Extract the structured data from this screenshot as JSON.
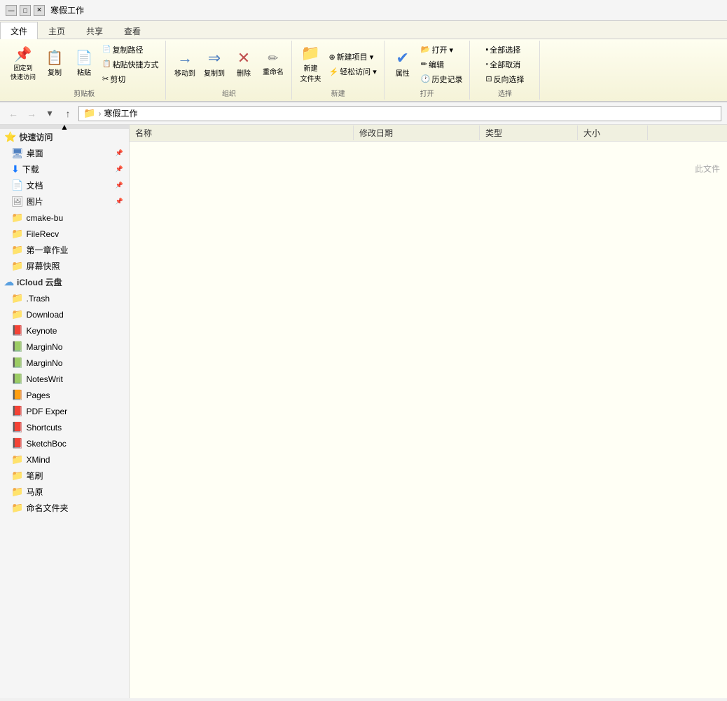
{
  "titleBar": {
    "icons": [
      "—",
      "□",
      "✕"
    ],
    "title": "寒假工作"
  },
  "ribbonTabs": [
    {
      "label": "文件",
      "active": true
    },
    {
      "label": "主页",
      "active": false
    },
    {
      "label": "共享",
      "active": false
    },
    {
      "label": "查看",
      "active": false
    }
  ],
  "ribbon": {
    "groups": [
      {
        "name": "clipboard",
        "label": "剪贴板",
        "buttons": [
          {
            "type": "large",
            "icon": "📌",
            "label": "固定到\n快速访问"
          },
          {
            "type": "large",
            "icon": "📋",
            "label": "复制"
          },
          {
            "type": "large",
            "icon": "📄",
            "label": "粘贴"
          },
          {
            "type": "small-col",
            "items": [
              {
                "label": "复制路径"
              },
              {
                "label": "粘贴快捷方式"
              },
              {
                "label": "✂ 剪切"
              }
            ]
          }
        ]
      },
      {
        "name": "organize",
        "label": "组织",
        "buttons": [
          {
            "type": "large-arrow",
            "label": "移动到"
          },
          {
            "type": "large-arrow",
            "label": "复制到"
          },
          {
            "type": "large-x",
            "label": "删除"
          },
          {
            "type": "large",
            "label": "重命名"
          }
        ]
      },
      {
        "name": "new",
        "label": "新建",
        "buttons": [
          {
            "type": "large-folder",
            "label": "新建\n文件夹"
          },
          {
            "type": "small-col",
            "items": [
              {
                "label": "⊕ 新建项目 ▾"
              },
              {
                "label": "⚡ 轻松访问 ▾"
              }
            ]
          }
        ]
      },
      {
        "name": "open",
        "label": "打开",
        "buttons": [
          {
            "type": "large-check",
            "label": "属性"
          },
          {
            "type": "small-col",
            "items": [
              {
                "label": "📂 打开 ▾"
              },
              {
                "label": "✏ 编辑"
              },
              {
                "label": "🕐 历史记录"
              }
            ]
          }
        ]
      },
      {
        "name": "select",
        "label": "选择",
        "buttons": [
          {
            "type": "small-col",
            "items": [
              {
                "label": "全部选择"
              },
              {
                "label": "全部取消"
              },
              {
                "label": "反向选择"
              }
            ]
          }
        ]
      }
    ]
  },
  "addressBar": {
    "backLabel": "←",
    "forwardLabel": "→",
    "dropLabel": "▾",
    "upLabel": "↑",
    "pathIcon": "📁",
    "pathSep": "›",
    "pathRoot": "寒假工作",
    "pathFull": "寒假工作"
  },
  "sidebar": {
    "scrollUp": "▲",
    "groups": [
      {
        "type": "header",
        "icon": "⭐",
        "label": "快速访问"
      },
      {
        "type": "pinned",
        "icon": "🖥",
        "label": "桌面",
        "pin": true
      },
      {
        "type": "pinned",
        "icon": "⬇",
        "label": "下载",
        "iconClass": "dl-icon",
        "pin": true
      },
      {
        "type": "pinned",
        "icon": "📄",
        "label": "文档",
        "iconClass": "doc-icon",
        "pin": true
      },
      {
        "type": "pinned",
        "icon": "🖼",
        "label": "图片",
        "iconClass": "img-icon",
        "pin": true
      },
      {
        "type": "folder",
        "icon": "📁",
        "label": "cmake-bu",
        "iconClass": "folder-yellow"
      },
      {
        "type": "folder",
        "icon": "📁",
        "label": "FileRecv",
        "iconClass": "folder-yellow"
      },
      {
        "type": "folder",
        "icon": "📁",
        "label": "第一章作业",
        "iconClass": "folder-yellow"
      },
      {
        "type": "folder",
        "icon": "📁",
        "label": "屏幕快照",
        "iconClass": "folder-yellow"
      },
      {
        "type": "header",
        "icon": "☁",
        "label": "iCloud 云盘",
        "iconClass": "icloud-icon"
      },
      {
        "type": "cloud-item",
        "icon": "📁",
        "label": ".Trash",
        "iconClass": "folder-yellow-light"
      },
      {
        "type": "cloud-item",
        "icon": "📁",
        "label": "Download",
        "iconClass": "folder-yellow"
      },
      {
        "type": "cloud-item",
        "icon": "📕",
        "label": "Keynote",
        "iconClass": "keynote-icon"
      },
      {
        "type": "cloud-item",
        "icon": "📗",
        "label": "MarginNo",
        "iconClass": "pages-icon"
      },
      {
        "type": "cloud-item",
        "icon": "📗",
        "label": "MarginNo",
        "iconClass": "pages-icon"
      },
      {
        "type": "cloud-item",
        "icon": "📗",
        "label": "NotesWrit",
        "iconClass": "pages-icon"
      },
      {
        "type": "cloud-item",
        "icon": "📙",
        "label": "Pages",
        "iconClass": "pages-icon"
      },
      {
        "type": "cloud-item",
        "icon": "📕",
        "label": "PDF Exper",
        "iconClass": "pdf-icon"
      },
      {
        "type": "cloud-item",
        "icon": "📕",
        "label": "Shortcuts",
        "iconClass": "shortcuts-icon"
      },
      {
        "type": "cloud-item",
        "icon": "📕",
        "label": "SketchBoc",
        "iconClass": "sketch-icon"
      },
      {
        "type": "cloud-item",
        "icon": "📁",
        "label": "XMind",
        "iconClass": "xmind-icon"
      },
      {
        "type": "cloud-item",
        "icon": "📁",
        "label": "笔刷",
        "iconClass": "folder-yellow"
      },
      {
        "type": "cloud-item",
        "icon": "📁",
        "label": "马原",
        "iconClass": "folder-yellow"
      },
      {
        "type": "cloud-item",
        "icon": "📁",
        "label": "命名文件夹",
        "iconClass": "folder-yellow"
      }
    ]
  },
  "fileList": {
    "columns": [
      {
        "label": "名称",
        "class": "col-name"
      },
      {
        "label": "修改日期",
        "class": "col-date"
      },
      {
        "label": "类型",
        "class": "col-type"
      },
      {
        "label": "大小",
        "class": "col-size"
      }
    ],
    "emptyHint": "此文件",
    "rows": []
  }
}
